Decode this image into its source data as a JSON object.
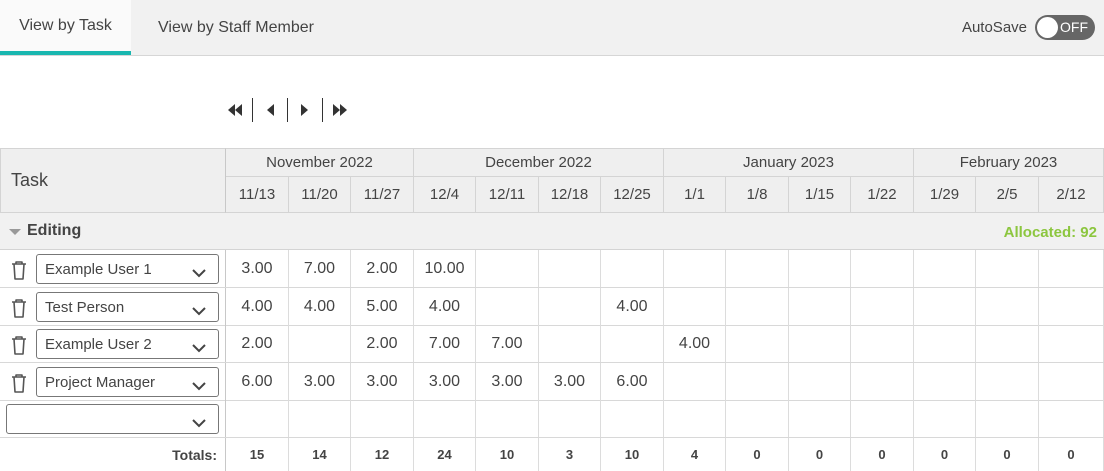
{
  "tabs": [
    {
      "label": "View by Task",
      "active": true
    },
    {
      "label": "View by Staff Member",
      "active": false
    }
  ],
  "autosave": {
    "label": "AutoSave",
    "state": "OFF"
  },
  "pager": {
    "icons": [
      "first-page-icon",
      "previous-page-icon",
      "next-page-icon",
      "last-page-icon"
    ]
  },
  "grid": {
    "task_header": "Task",
    "months": [
      "November 2022",
      "December 2022",
      "January 2023",
      "February 2023"
    ],
    "weeks": [
      "11/13",
      "11/20",
      "11/27",
      "12/4",
      "12/11",
      "12/18",
      "12/25",
      "1/1",
      "1/8",
      "1/15",
      "1/22",
      "1/29",
      "2/5",
      "2/12"
    ],
    "group": {
      "name": "Editing",
      "allocated": "Allocated: 92"
    },
    "rows": [
      {
        "staff": "Example User 1",
        "values": [
          "3.00",
          "7.00",
          "2.00",
          "10.00",
          "",
          "",
          "",
          "",
          "",
          "",
          "",
          "",
          "",
          ""
        ]
      },
      {
        "staff": "Test Person",
        "values": [
          "4.00",
          "4.00",
          "5.00",
          "4.00",
          "",
          "",
          "4.00",
          "",
          "",
          "",
          "",
          "",
          "",
          ""
        ]
      },
      {
        "staff": "Example User 2",
        "values": [
          "2.00",
          "",
          "2.00",
          "7.00",
          "7.00",
          "",
          "",
          "4.00",
          "",
          "",
          "",
          "",
          "",
          ""
        ]
      },
      {
        "staff": "Project Manager",
        "values": [
          "6.00",
          "3.00",
          "3.00",
          "3.00",
          "3.00",
          "3.00",
          "6.00",
          "",
          "",
          "",
          "",
          "",
          "",
          ""
        ]
      }
    ],
    "new_row": {
      "staff": ""
    },
    "totals_label": "Totals:",
    "totals": [
      "15",
      "14",
      "12",
      "24",
      "10",
      "3",
      "10",
      "4",
      "0",
      "0",
      "0",
      "0",
      "0",
      "0"
    ]
  },
  "colors": {
    "accent_tab": "#19b7b0",
    "allocated": "#8cc63f",
    "toggle_off": "#666666"
  }
}
